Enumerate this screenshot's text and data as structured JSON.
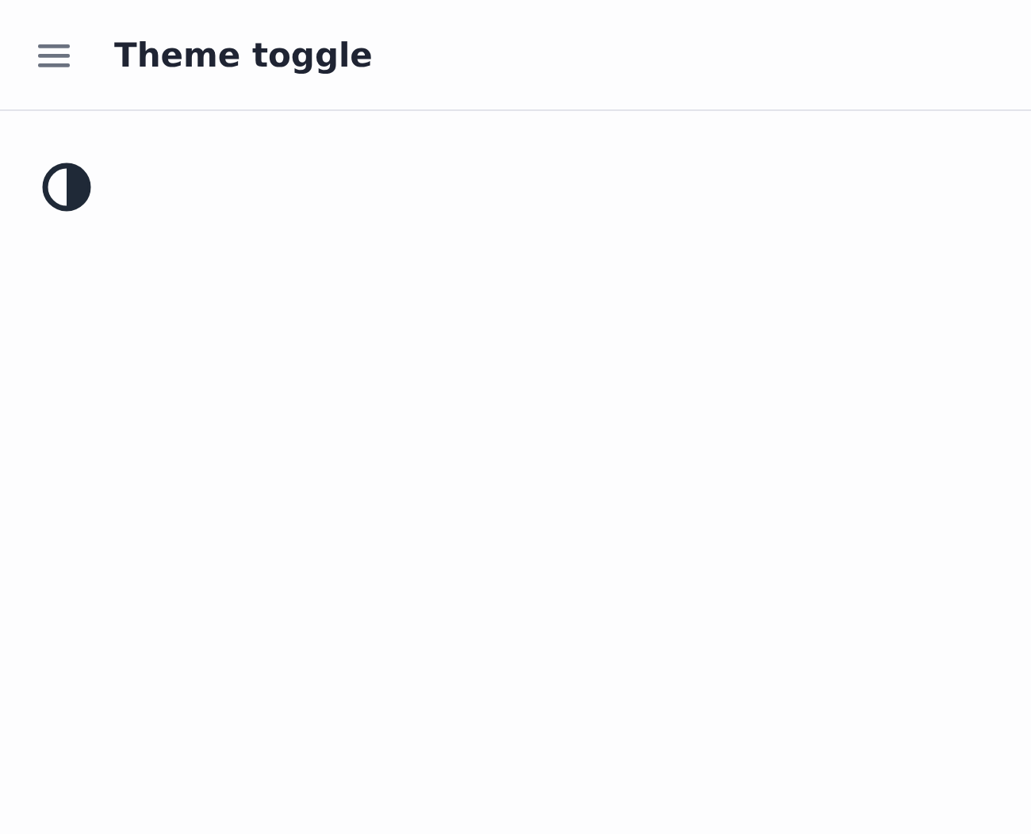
{
  "header": {
    "title": "Theme toggle"
  }
}
